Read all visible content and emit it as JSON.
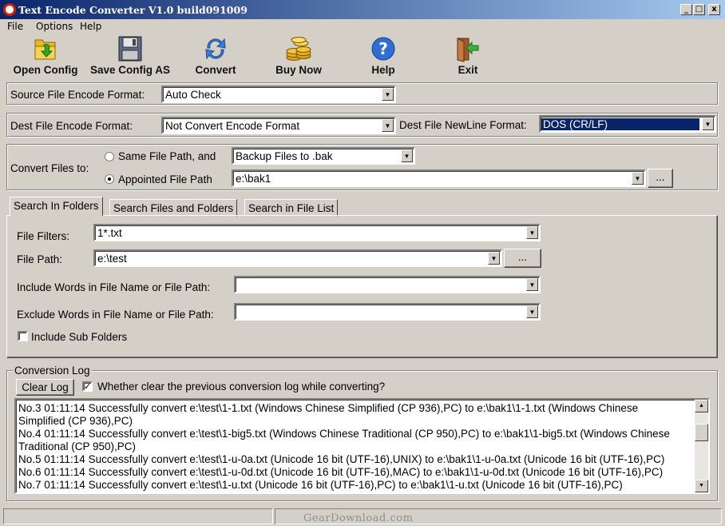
{
  "window": {
    "title": "Text Encode Converter V1.0 build091009",
    "minimize": "_",
    "maximize": "□",
    "close": "x"
  },
  "menu": {
    "file": "File",
    "options": "Options",
    "help": "Help"
  },
  "toolbar": {
    "open_config": "Open Config",
    "save_config_as": "Save Config AS",
    "convert": "Convert",
    "buy_now": "Buy Now",
    "help": "Help",
    "exit": "Exit"
  },
  "source": {
    "label": "Source File Encode Format:",
    "value": "Auto Check"
  },
  "dest": {
    "label": "Dest File Encode Format:",
    "value": "Not Convert Encode Format",
    "newline_label": "Dest File NewLine Format:",
    "newline_value": "DOS (CR/LF)"
  },
  "convert_to": {
    "label": "Convert Files to:",
    "option_same": "Same File Path, and",
    "backup_value": "Backup Files to .bak",
    "option_appointed": "Appointed File Path",
    "appointed_value": "e:\\bak1",
    "browse": "..."
  },
  "tabs": [
    {
      "label": "Search In Folders"
    },
    {
      "label": "Search Files and Folders"
    },
    {
      "label": "Search in File List"
    }
  ],
  "search": {
    "filters_label": "File Filters:",
    "filters_value": "1*.txt",
    "path_label": "File Path:",
    "path_value": "e:\\test",
    "browse": "...",
    "include_label": "Include Words in File Name or File Path:",
    "include_value": "",
    "exclude_label": "Exclude Words in File Name or File Path:",
    "exclude_value": "",
    "subfolders_label": "Include Sub Folders"
  },
  "log": {
    "group_label": "Conversion Log",
    "clear_button": "Clear Log",
    "clear_check_label": "Whether clear the previous conversion log while converting?",
    "lines": [
      "No.3 01:11:14 Successfully convert e:\\test\\1-1.txt (Windows Chinese Simplified (CP 936),PC) to e:\\bak1\\1-1.txt (Windows Chinese",
      "Simplified (CP 936),PC)",
      "No.4 01:11:14 Successfully convert e:\\test\\1-big5.txt (Windows Chinese Traditional (CP 950),PC) to e:\\bak1\\1-big5.txt (Windows Chinese",
      "Traditional (CP 950),PC)",
      "No.5 01:11:14 Successfully convert e:\\test\\1-u-0a.txt (Unicode 16 bit (UTF-16),UNIX) to e:\\bak1\\1-u-0a.txt (Unicode 16 bit (UTF-16),PC)",
      "No.6 01:11:14 Successfully convert e:\\test\\1-u-0d.txt (Unicode 16 bit (UTF-16),MAC) to e:\\bak1\\1-u-0d.txt (Unicode 16 bit (UTF-16),PC)",
      "No.7 01:11:14 Successfully convert e:\\test\\1-u.txt (Unicode 16 bit (UTF-16),PC) to e:\\bak1\\1-u.txt (Unicode 16 bit (UTF-16),PC)"
    ]
  },
  "watermark": "GearDownload.com"
}
